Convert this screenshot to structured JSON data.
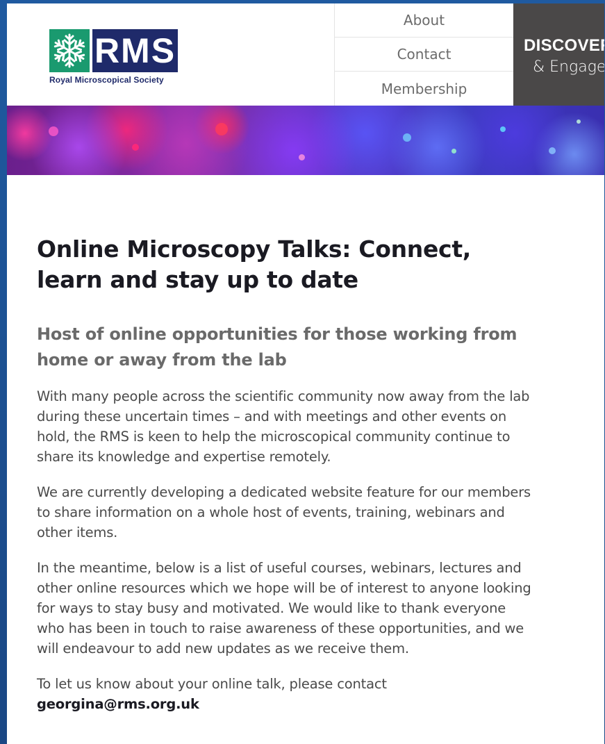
{
  "logo": {
    "text": "RMS",
    "caption": "Royal Microscopical Society",
    "colors": {
      "snowflake_bg": "#1a9a6f",
      "text_bg": "#1f2a6a"
    }
  },
  "nav": {
    "items": [
      {
        "label": "About"
      },
      {
        "label": "Contact"
      },
      {
        "label": "Membership"
      }
    ]
  },
  "discover": {
    "title": "DISCOVER",
    "subtitle": "& Engage",
    "bg_color": "#4a4848"
  },
  "article": {
    "title": "Online Microscopy Talks: Connect, learn and stay up to date",
    "subtitle": "Host of online opportunities for those working from home or away from the lab",
    "paragraphs": [
      "With many people across the scientific community now away from the lab during these uncertain times – and with meetings and other events on hold, the RMS is keen to help the microscopical community continue to share its knowledge and expertise remotely.",
      "We are currently developing a dedicated website feature for our members to share information on a whole host of events, training, webinars and other items.",
      "In the meantime, below is a list of useful courses, webinars, lectures and other online resources which we hope will be of interest to anyone looking for ways to stay busy and motivated. We would like to thank everyone who has been in touch to raise awareness of these opportunities, and we will endeavour to add new updates as we receive them."
    ],
    "contact_text": "To let us know about your online talk, please contact",
    "contact_email": "georgina@rms.org.uk"
  }
}
